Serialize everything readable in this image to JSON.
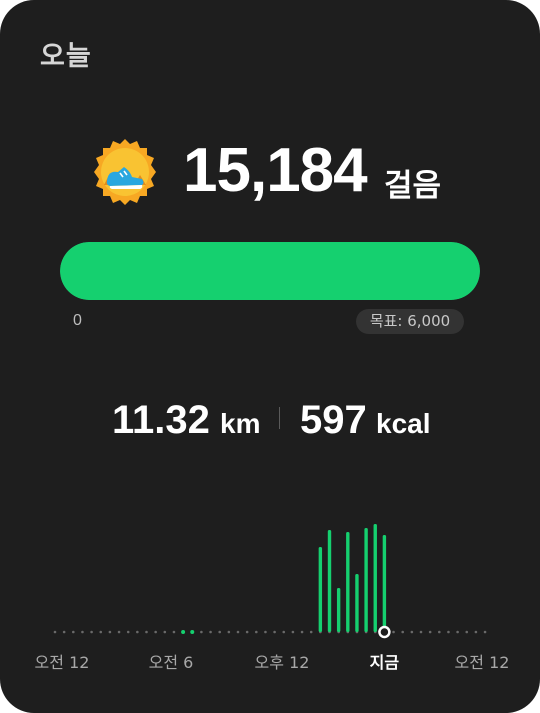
{
  "header": {
    "title": "오늘"
  },
  "steps": {
    "count": "15,184",
    "unit": "걸음",
    "badge_icon": "running-shoe-badge-icon"
  },
  "progress": {
    "min_label": "0",
    "goal_label": "목표: 6,000",
    "fraction": 1.0
  },
  "stats": {
    "distance_value": "11.32",
    "distance_unit": "km",
    "calories_value": "597",
    "calories_unit": "kcal"
  },
  "colors": {
    "accent": "#15d06f",
    "background": "#1e1e1e",
    "track": "#333333"
  },
  "chart_data": {
    "type": "bar",
    "x_labels": [
      "오전 12",
      "오전 6",
      "오후 12",
      "지금",
      "오전 12"
    ],
    "current_marker_label": "지금",
    "series": [
      {
        "values": [
          0,
          0,
          0,
          0,
          0,
          0,
          0,
          0,
          0,
          0,
          0,
          0,
          0,
          0,
          0.2,
          0.2,
          0,
          0,
          0,
          0,
          0,
          0,
          0,
          0,
          0,
          0,
          0,
          0,
          0,
          85,
          102,
          44,
          100,
          58,
          104,
          108,
          97
        ]
      }
    ],
    "grid": false
  }
}
